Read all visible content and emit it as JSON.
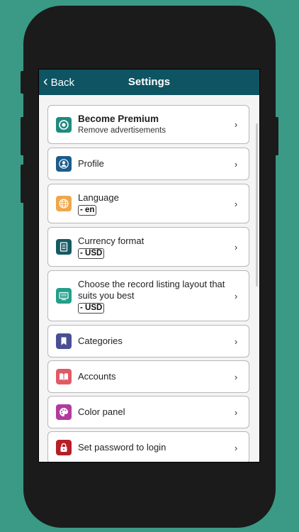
{
  "navbar": {
    "back_label": "Back",
    "title": "Settings"
  },
  "items": [
    {
      "name": "premium",
      "title": "Become Premium",
      "subtitle": "Remove advertisements",
      "icon": "premium-icon",
      "color": "#1f8a7f"
    },
    {
      "name": "profile",
      "title": "Profile",
      "icon": "profile-icon",
      "color": "#1a5c8c"
    },
    {
      "name": "language",
      "title": "Language",
      "value": "- en",
      "icon": "globe-icon",
      "color": "#f0a64a"
    },
    {
      "name": "currency",
      "title": "Currency format",
      "value": "- USD",
      "icon": "document-icon",
      "color": "#145a64"
    },
    {
      "name": "layout",
      "title": "Choose the record listing layout that suits you best",
      "value": "- USD",
      "icon": "layout-icon",
      "color": "#22a08a"
    },
    {
      "name": "categories",
      "title": "Categories",
      "icon": "bookmark-icon",
      "color": "#4a4f94"
    },
    {
      "name": "accounts",
      "title": "Accounts",
      "icon": "book-icon",
      "color": "#e05a66"
    },
    {
      "name": "color-panel",
      "title": "Color panel",
      "icon": "palette-icon",
      "color": "#b23a9e"
    },
    {
      "name": "password",
      "title": "Set password to login",
      "icon": "lock-icon",
      "color": "#b51f28"
    }
  ]
}
